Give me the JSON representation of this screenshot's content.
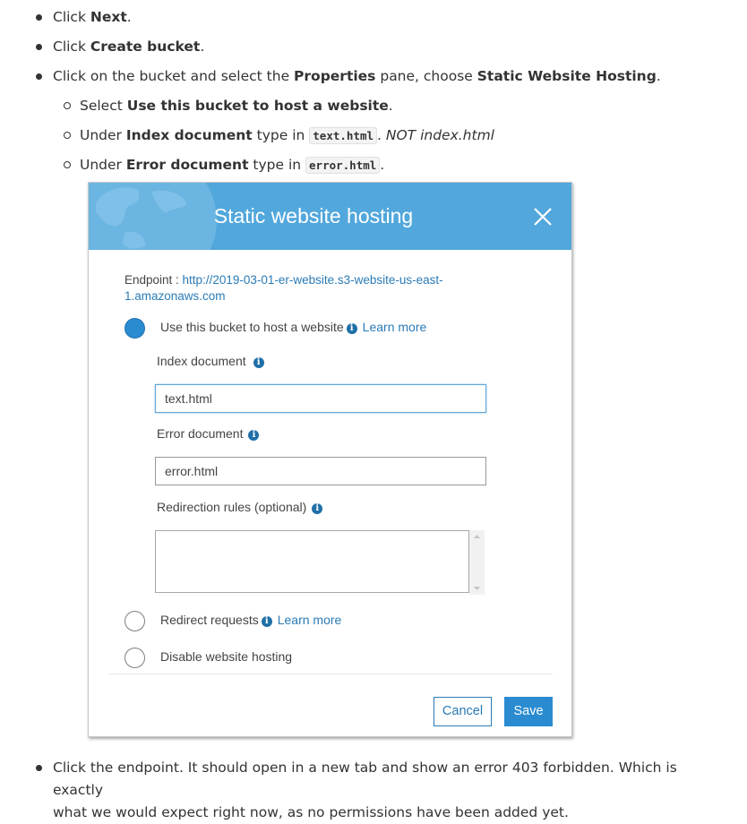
{
  "steps": {
    "s1": {
      "prefix": "Click ",
      "bold": "Next",
      "suffix": "."
    },
    "s2": {
      "prefix": "Click ",
      "bold": "Create bucket",
      "suffix": "."
    },
    "s3": {
      "prefix": "Click on the bucket and select the ",
      "bold1": "Properties",
      "mid": " pane, choose ",
      "bold2": "Static Website Hosting",
      "suffix": "."
    },
    "sub1": {
      "prefix": "Select ",
      "bold": "Use this bucket to host a website",
      "suffix": "."
    },
    "sub2": {
      "prefix": "Under ",
      "bold": "Index document",
      "mid": " type in ",
      "code": "text.html",
      "after": ". ",
      "italic": "NOT index.html"
    },
    "sub3": {
      "prefix": "Under ",
      "bold": "Error document",
      "mid": " type in ",
      "code": "error.html",
      "suffix": "."
    },
    "s4": {
      "text1": "Click the endpoint.  It should open in a new tab and show an error 403 forbidden. Which is exactly",
      "text2": "what we would expect right now, as no permissions have been added yet."
    }
  },
  "modal": {
    "title": "Static website hosting",
    "endpoint_label": "Endpoint : ",
    "endpoint_url_line1": "http://2019-03-01-er-website.s3-website-us-east-",
    "endpoint_url_line2": "1.amazonaws.com",
    "options": {
      "host": {
        "label": "Use this bucket to host a website",
        "learn_more": "Learn more",
        "selected": true
      },
      "redirect": {
        "label": "Redirect requests",
        "learn_more": "Learn more",
        "selected": false
      },
      "disable": {
        "label": "Disable website hosting",
        "selected": false
      }
    },
    "index_document": {
      "label": "Index document",
      "value": "text.html"
    },
    "error_document": {
      "label": "Error document",
      "value": "error.html"
    },
    "redirection_rules": {
      "label": "Redirection rules (optional)",
      "value": ""
    },
    "cancel_label": "Cancel",
    "save_label": "Save",
    "colors": {
      "header": "#52a7dc",
      "primary": "#2a8bd1",
      "link": "#2a7bb6"
    }
  }
}
